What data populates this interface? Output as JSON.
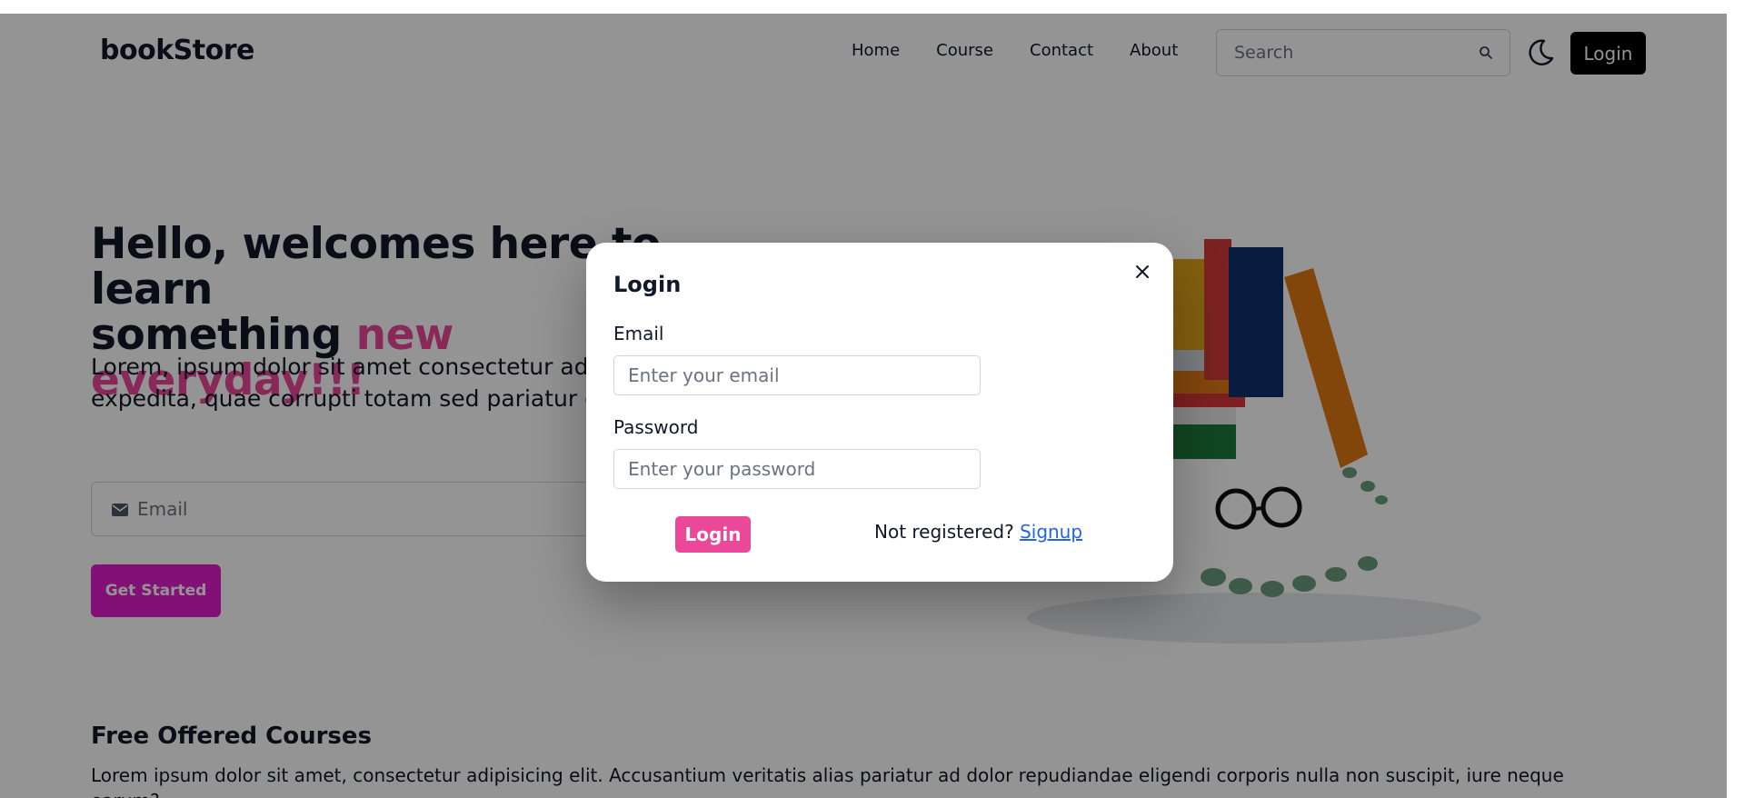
{
  "navbar": {
    "brand": "bookStore",
    "links": [
      "Home",
      "Course",
      "Contact",
      "About"
    ],
    "search_placeholder": "Search",
    "login_label": "Login"
  },
  "hero": {
    "title_line1": "Hello, welcomes here to learn",
    "title_line2_prefix": "something ",
    "title_highlight": "new everyday!!!",
    "paragraph": "Lorem, ipsum dolor sit amet consectetur adipisicing elit. Dolor, et totam. Tempora amet atque expedita, quae corrupti totam sed pariatur corporis at veniam est voluptas animi!",
    "email_placeholder": "Email",
    "cta_label": "Get Started"
  },
  "courses": {
    "title": "Free Offered Courses",
    "paragraph": "Lorem ipsum dolor sit amet, consectetur adipisicing elit. Accusantium veritatis alias pariatur ad dolor repudiandae eligendi corporis nulla non suscipit, iure neque earum?"
  },
  "modal": {
    "title": "Login",
    "email_label": "Email",
    "email_placeholder": "Enter your email",
    "password_label": "Password",
    "password_placeholder": "Enter your password",
    "login_label": "Login",
    "not_registered": "Not registered?",
    "signup_label": "Signup"
  },
  "colors": {
    "accent_pink": "#ec4899",
    "cta_magenta": "#e11dcc",
    "link_blue": "#2563eb",
    "dark": "#000000"
  },
  "icons": {
    "search": "search-icon",
    "theme": "moon-icon",
    "mail": "mail-icon",
    "close": "close-icon"
  }
}
